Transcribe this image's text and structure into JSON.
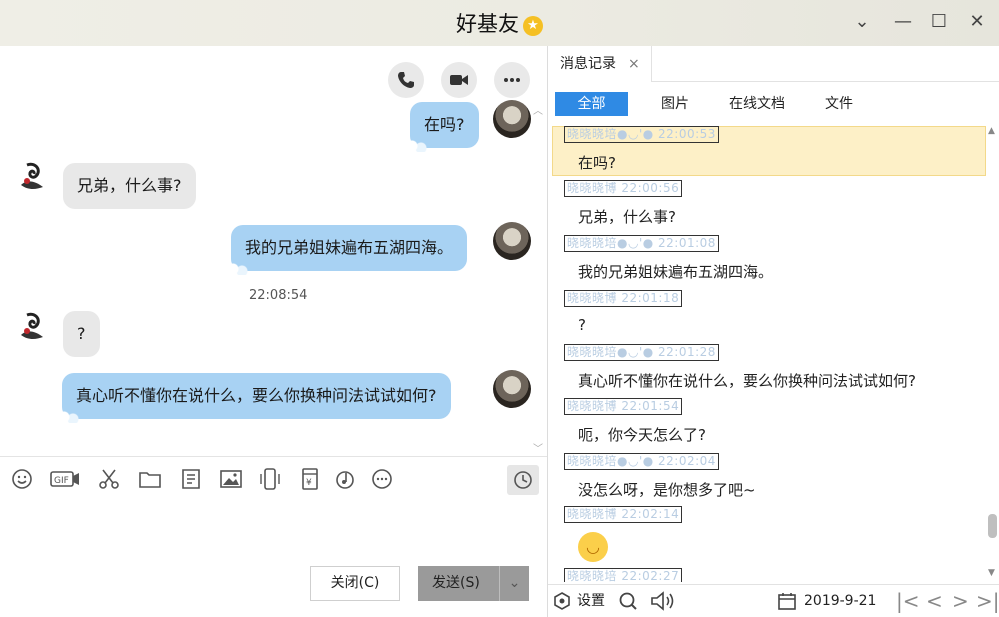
{
  "window": {
    "title": "好基友",
    "star_icon": "star-badge-icon"
  },
  "chat": {
    "messages": [
      {
        "from": "me",
        "text": "在吗?"
      },
      {
        "from": "friend",
        "text": "兄弟，什么事?"
      },
      {
        "from": "me",
        "text": "我的兄弟姐妹遍布五湖四海。"
      },
      {
        "from": "friend",
        "text": "?"
      },
      {
        "from": "me",
        "text": "真心听不懂你在说什么，要么你换种问法试试如何?"
      }
    ],
    "timestamp": "22:08:54"
  },
  "input": {
    "close_label": "关闭(C)",
    "send_label": "发送(S)"
  },
  "history": {
    "tab_label": "消息记录",
    "filters": [
      "全部",
      "图片",
      "在线文档",
      "文件"
    ],
    "records": [
      {
        "name": "晓晓晓培●◡'● 22:00:53",
        "text": "在吗?"
      },
      {
        "name": "晓晓晓博 22:00:56",
        "text": "兄弟，什么事?"
      },
      {
        "name": "晓晓晓培●◡'● 22:01:08",
        "text": "我的兄弟姐妹遍布五湖四海。"
      },
      {
        "name": "晓晓晓博 22:01:18",
        "text": "?"
      },
      {
        "name": "晓晓晓培●◡'● 22:01:28",
        "text": "真心听不懂你在说什么，要么你换种问法试试如何?"
      },
      {
        "name": "晓晓晓博 22:01:54",
        "text": "呃，你今天怎么了?"
      },
      {
        "name": "晓晓晓培●◡'● 22:02:04",
        "text": "没怎么呀，是你想多了吧~"
      },
      {
        "name": "晓晓晓博 22:02:14",
        "text": ""
      },
      {
        "name": "晓晓晓培 22:02:27",
        "text": ""
      }
    ],
    "settings_label": "设置",
    "date": "2019-9-21"
  },
  "colors": {
    "accent": "#2f8ae4",
    "my_bubble": "#a8d2f3",
    "their_bubble": "#e8e8e8",
    "highlight": "#fdf0c7"
  }
}
